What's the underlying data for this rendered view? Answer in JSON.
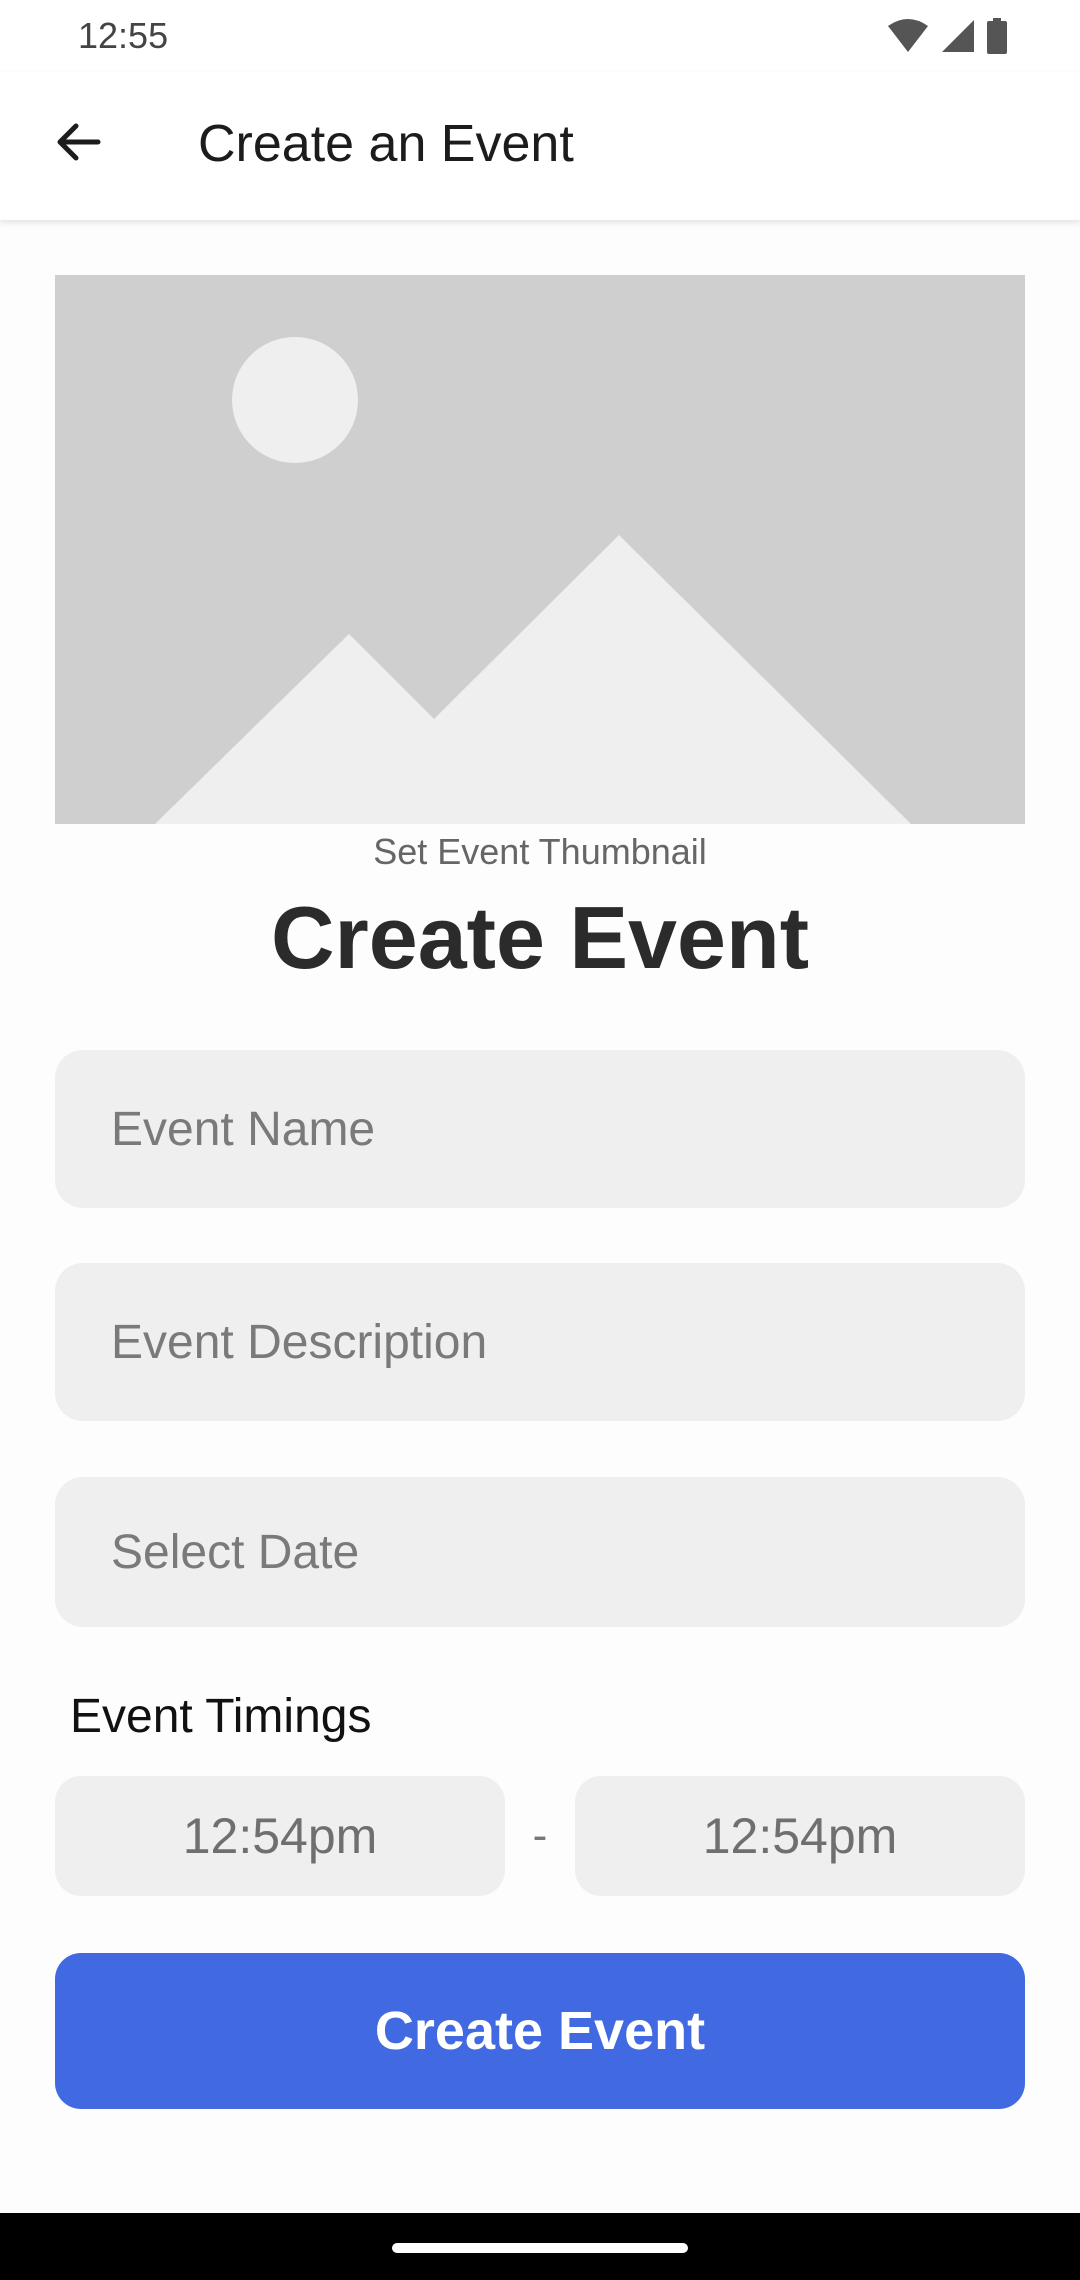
{
  "status_bar": {
    "time": "12:55",
    "icons": [
      "wifi-icon",
      "signal-icon",
      "battery-icon"
    ]
  },
  "app_bar": {
    "back_icon": "arrow-back-icon",
    "title": "Create an Event"
  },
  "thumbnail": {
    "icon": "image-placeholder-icon",
    "caption": "Set Event Thumbnail"
  },
  "form": {
    "heading": "Create Event",
    "event_name_placeholder": "Event Name",
    "event_description_placeholder": "Event Description",
    "date_placeholder": "Select Date",
    "timings_label": "Event Timings",
    "start_time": "12:54pm",
    "separator": "-",
    "end_time": "12:54pm",
    "submit_label": "Create Event"
  },
  "colors": {
    "primary": "#4169e1",
    "field_background": "#efefef",
    "placeholder_background": "#cfcfcf"
  }
}
